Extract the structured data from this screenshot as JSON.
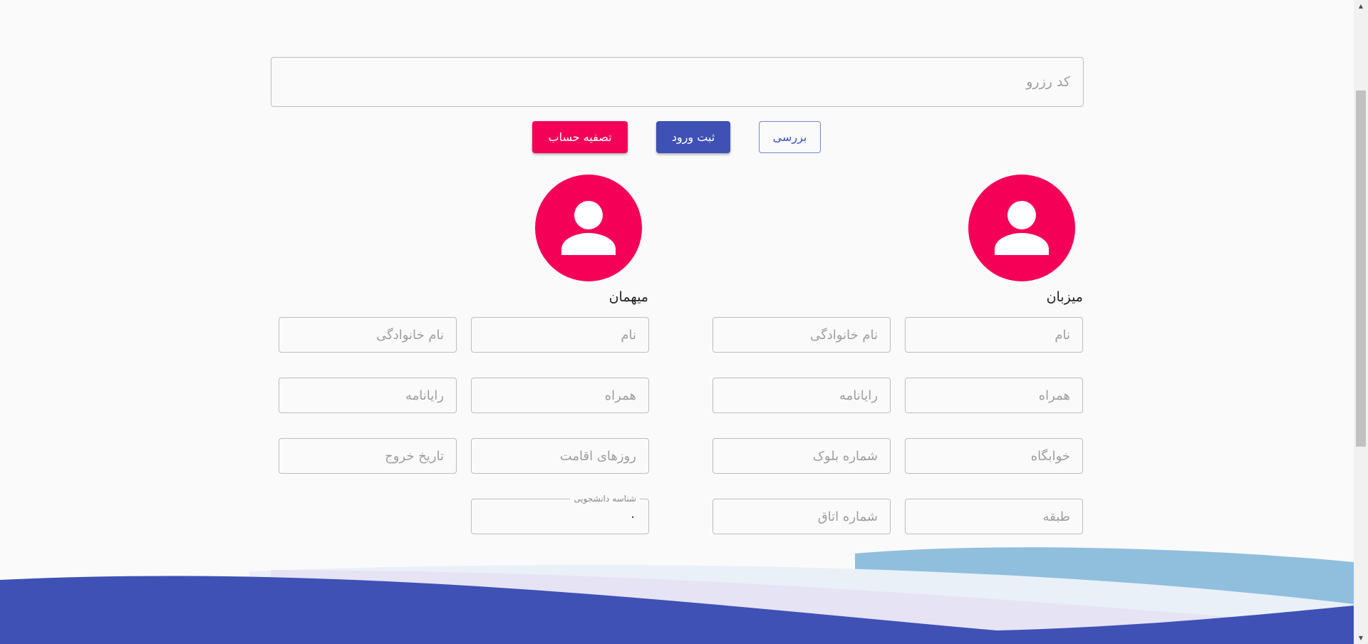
{
  "reservation": {
    "code_placeholder": "کد رزرو"
  },
  "actions": {
    "check_label": "بررسی",
    "checkin_label": "ثبت ورود",
    "settle_label": "تصفیه حساب"
  },
  "host": {
    "title": "میزبان",
    "first_name_placeholder": "نام",
    "last_name_placeholder": "نام خانوادگی",
    "mobile_placeholder": "همراه",
    "email_placeholder": "رایانامه",
    "dorm_placeholder": "خوابگاه",
    "block_placeholder": "شماره بلوک",
    "floor_placeholder": "طبقه",
    "room_placeholder": "شماره اتاق"
  },
  "guest": {
    "title": "میهمان",
    "first_name_placeholder": "نام",
    "last_name_placeholder": "نام خانوادگی",
    "mobile_placeholder": "همراه",
    "email_placeholder": "رایانامه",
    "stay_days_placeholder": "روزهای اقامت",
    "checkout_placeholder": "تاریخ خروج",
    "student_id_label": "شناسه دانشجویی",
    "student_id_value": "۰"
  },
  "colors": {
    "primary": "#3f51b5",
    "accent": "#f50057",
    "background": "#fafafa",
    "wave_light_blue": "#90bfdd",
    "wave_pale": "#e9f0f8",
    "wave_lavender": "#e6e3f5"
  },
  "icons": {
    "avatar": "person-icon"
  }
}
